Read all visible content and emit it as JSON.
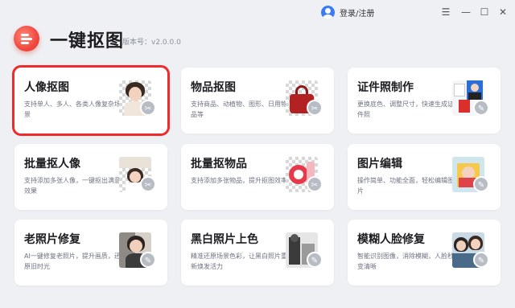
{
  "app": {
    "title": "一键抠图",
    "version": "版本号：v2.0.0.0"
  },
  "header": {
    "login_label": "登录/注册"
  },
  "window_controls": {
    "menu_glyph": "☰",
    "minimize_glyph": "—",
    "maximize_glyph": "☐",
    "close_glyph": "✕"
  },
  "colors": {
    "accent": "#ef2b2b",
    "background": "#eef0f4",
    "user_icon": "#3b7bf5"
  },
  "cards": [
    {
      "title": "人像抠图",
      "desc": "支持单人、多人、各类人像复杂场景",
      "icon": "portrait-cutout-icon",
      "selected": true
    },
    {
      "title": "物品抠图",
      "desc": "支持商品、动植物、图形、日用物品等",
      "icon": "handbag-cutout-icon",
      "selected": false
    },
    {
      "title": "证件照制作",
      "desc": "更换底色、调整尺寸，快速生成证件照",
      "icon": "id-photo-icon",
      "selected": false
    },
    {
      "title": "批量抠人像",
      "desc": "支持添加多张人像，一键抠出满意效果",
      "icon": "batch-portrait-icon",
      "selected": false
    },
    {
      "title": "批量抠物品",
      "desc": "支持添加多张物品，提升抠图效率",
      "icon": "batch-object-icon",
      "selected": false
    },
    {
      "title": "图片编辑",
      "desc": "操作简单、功能全面，轻松编辑图片",
      "icon": "image-edit-icon",
      "selected": false
    },
    {
      "title": "老照片修复",
      "desc": "AI一键修复老照片，提升画质，还原旧时光",
      "icon": "old-photo-icon",
      "selected": false
    },
    {
      "title": "黑白照片上色",
      "desc": "精准还原场景色彩，让黑白照片重新焕发活力",
      "icon": "colorize-icon",
      "selected": false
    },
    {
      "title": "模糊人脸修复",
      "desc": "智能识别图像，消除模糊，人脸秒变清晰",
      "icon": "face-restore-icon",
      "selected": false
    }
  ]
}
